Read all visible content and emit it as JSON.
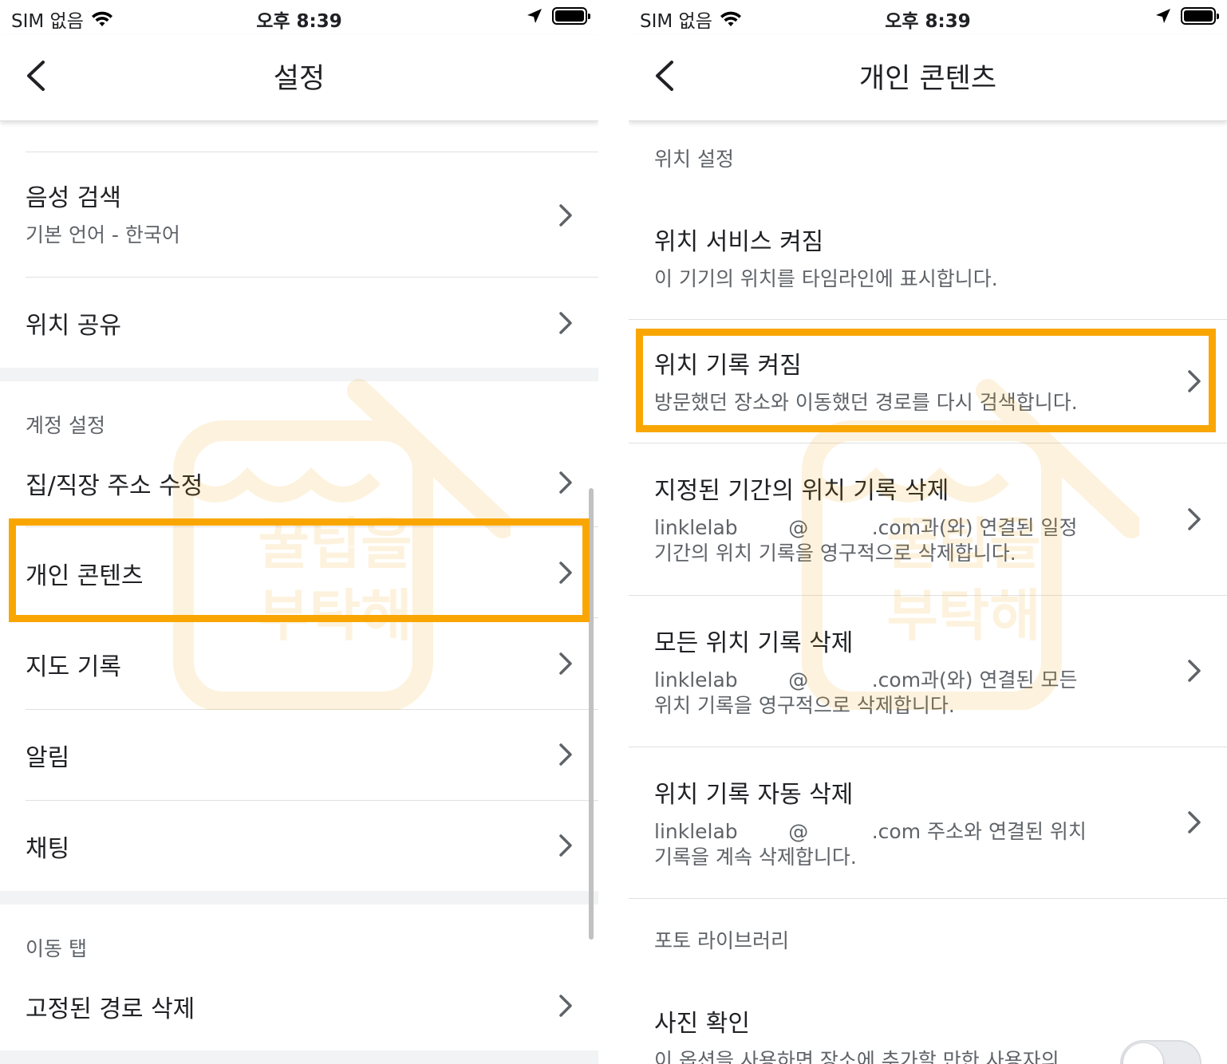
{
  "colors": {
    "highlight": "#f9a602",
    "text_primary": "#202124",
    "text_secondary": "#5f6368",
    "divider": "#e0e0e0",
    "band": "#f1f3f4"
  },
  "left": {
    "status": {
      "carrier": "SIM 없음",
      "time": "오후 8:39"
    },
    "title": "설정",
    "items": {
      "voice_search": {
        "label": "음성 검색",
        "sub": "기본 언어 - 한국어"
      },
      "location_sharing": {
        "label": "위치 공유"
      },
      "section_account": "계정 설정",
      "edit_home_work": {
        "label": "집/직장 주소 수정"
      },
      "personal_content": {
        "label": "개인 콘텐츠"
      },
      "maps_history": {
        "label": "지도 기록"
      },
      "notifications": {
        "label": "알림"
      },
      "chat": {
        "label": "채팅"
      },
      "section_commute": "이동 탭",
      "delete_pinned_routes": {
        "label": "고정된 경로 삭제"
      }
    }
  },
  "right": {
    "status": {
      "carrier": "SIM 없음",
      "time": "오후 8:39"
    },
    "title": "개인 콘텐츠",
    "section_location": "위치 설정",
    "location_services": {
      "label": "위치 서비스 켜짐",
      "sub": "이 기기의 위치를 타임라인에 표시합니다."
    },
    "location_history": {
      "label": "위치 기록 켜짐",
      "sub": "방문했던 장소와 이동했던 경로를 다시 검색합니다."
    },
    "delete_range": {
      "label": "지정된 기간의 위치 기록 삭제",
      "sub1": "linklelab        @          .com과(와) 연결된 일정",
      "sub2": "기간의 위치 기록을 영구적으로 삭제합니다."
    },
    "delete_all": {
      "label": "모든 위치 기록 삭제",
      "sub1": "linklelab        @          .com과(와) 연결된 모든",
      "sub2": "위치 기록을 영구적으로 삭제합니다."
    },
    "auto_delete": {
      "label": "위치 기록 자동 삭제",
      "sub1": "linklelab        @          .com 주소와 연결된 위치",
      "sub2": "기록을 계속 삭제합니다."
    },
    "section_photo": "포토 라이브러리",
    "photo_check": {
      "label": "사진 확인",
      "sub": "이 옵션을 사용하면 장소에 추가할 만한 사용자의",
      "enabled": false
    }
  },
  "watermark": {
    "line1": "꿀팁을",
    "line2": "부탁해"
  }
}
